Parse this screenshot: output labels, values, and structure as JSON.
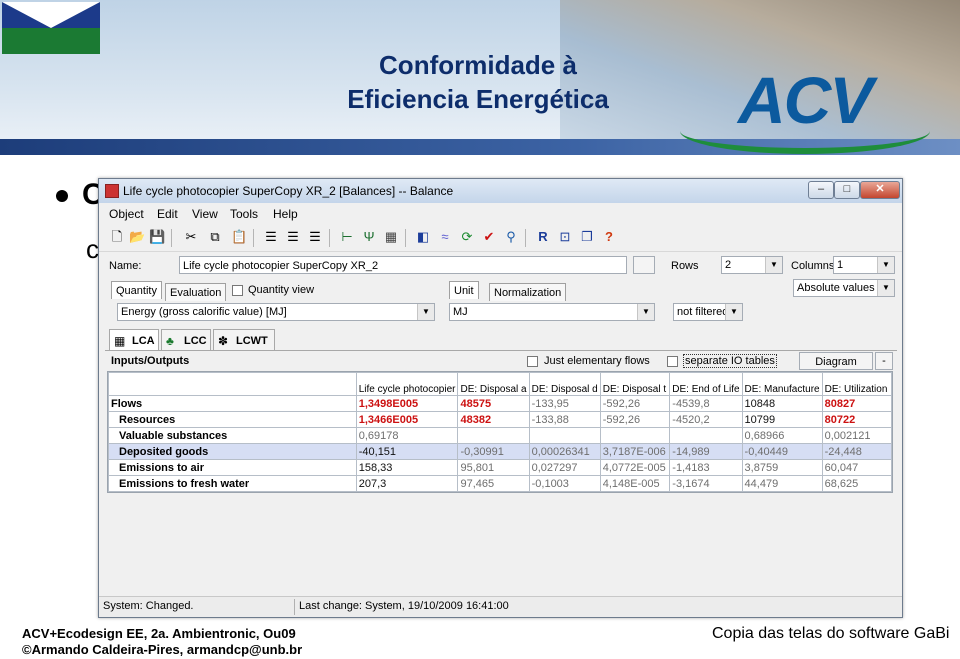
{
  "slide": {
    "title_line1": "Conformidade à",
    "title_line2": "Eficiencia Energética",
    "logo_text": "ACV",
    "bullet_partial_1": "C",
    "bullet_partial_2": "c",
    "footer_line1": "ACV+Ecodesign EE, 2a. Ambientronic, Ou09",
    "footer_line2": "©Armando Caldeira-Pires, armandcp@unb.br",
    "footer_right": "Copia das telas do software GaBi"
  },
  "window": {
    "title": "Life cycle photocopier SuperCopy XR_2 [Balances] -- Balance",
    "controls": {
      "minimize": "–",
      "maximize": "□",
      "close": "✕"
    }
  },
  "menu": [
    "Object",
    "Edit",
    "View",
    "Tools",
    "Help"
  ],
  "toolbar_icons": [
    "new-icon",
    "open-icon",
    "save-icon",
    "print-icon",
    "cut-icon",
    "copy-icon",
    "paste-icon",
    "align-left-icon",
    "align-center-icon",
    "align-right-icon",
    "tree-icon",
    "filter-icon",
    "table-icon",
    "chart-icon",
    "trend-icon",
    "refresh-icon",
    "check-icon",
    "search-icon",
    "report-icon",
    "zoom-icon",
    "window-icon",
    "help-icon"
  ],
  "form": {
    "name_label": "Name:",
    "name_value": "Life cycle photocopier SuperCopy XR_2",
    "rows_label": "Rows",
    "rows_value": "2",
    "columns_label": "Columns",
    "columns_value": "1",
    "tabs_left": [
      "Quantity",
      "Evaluation"
    ],
    "quantity_view_label": "Quantity view",
    "tabs_right": [
      "Unit",
      "Normalization"
    ],
    "absolute_values": "Absolute values",
    "quantity_value": "Energy (gross calorific value) [MJ]",
    "unit_value": "MJ",
    "filter_value": "not filtered"
  },
  "mode_tabs": [
    "LCA",
    "LCC",
    "LCWT"
  ],
  "grid_header": {
    "title": "Inputs/Outputs",
    "elementary_flows_label": "Just elementary flows",
    "separate_io_label": "separate IO tables",
    "diagram_label": "Diagram",
    "diagram_btn": "-"
  },
  "table": {
    "columns": [
      "",
      "Life cycle photocopier",
      "DE: Disposal a",
      "DE: Disposal d",
      "DE: Disposal t",
      "DE: End of Life",
      "DE: Manufacture",
      "DE: Utilization"
    ],
    "rows": [
      {
        "name": "Flows",
        "values": [
          "1,3498E005",
          "48575",
          "-133,95",
          "-592,26",
          "-4539,8",
          "10848",
          "80827"
        ],
        "style": "red"
      },
      {
        "name": "Resources",
        "values": [
          "1,3466E005",
          "48382",
          "-133,88",
          "-592,26",
          "-4520,2",
          "10799",
          "80722"
        ],
        "style": "red"
      },
      {
        "name": "Valuable substances",
        "values": [
          "0,69178",
          "",
          "",
          "",
          "",
          "0,68966",
          "0,002121"
        ],
        "style": "gray"
      },
      {
        "name": "Deposited goods",
        "values": [
          "-40,151",
          "-0,30991",
          "0,00026341",
          "3,7187E-006",
          "-14,989",
          "-0,40449",
          "-24,448"
        ],
        "style": "gray"
      },
      {
        "name": "Emissions to air",
        "values": [
          "158,33",
          "95,801",
          "0,027297",
          "4,0772E-005",
          "-1,4183",
          "3,8759",
          "60,047"
        ],
        "style": "gray"
      },
      {
        "name": "Emissions to fresh water",
        "values": [
          "207,3",
          "97,465",
          "-0,1003",
          "4,148E-005",
          "-3,1674",
          "44,479",
          "68,625"
        ],
        "style": "gray"
      }
    ]
  },
  "status": {
    "left": "System: Changed.",
    "right": "Last change: System, 19/10/2009 16:41:00"
  }
}
